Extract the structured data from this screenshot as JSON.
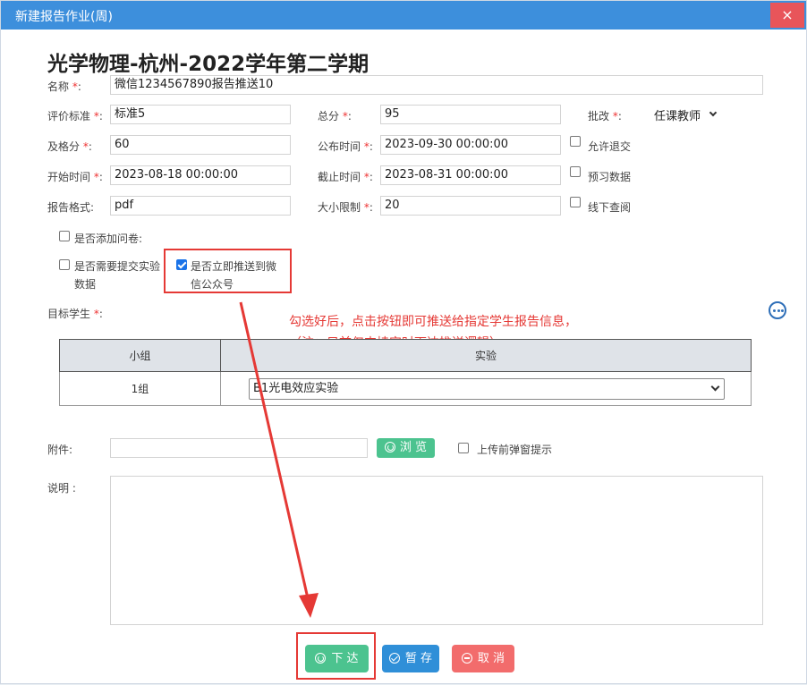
{
  "dialog": {
    "title": "新建报告作业(周)",
    "close_symbol": "×"
  },
  "heading": "光学物理-杭州-2022学年第二学期",
  "required_mark": "*",
  "fields": {
    "name": {
      "label": "名称",
      "value": "微信1234567890报告推送10"
    },
    "criteria": {
      "label": "评价标准",
      "value": "标准5"
    },
    "total": {
      "label": "总分",
      "value": "95"
    },
    "grader": {
      "label": "批改",
      "value": "任课教师"
    },
    "pass": {
      "label": "及格分",
      "value": "60"
    },
    "publish_time": {
      "label": "公布时间",
      "value": "2023-09-30 00:00:00"
    },
    "start_time": {
      "label": "开始时间",
      "value": "2023-08-18 00:00:00"
    },
    "deadline": {
      "label": "截止时间",
      "value": "2023-08-31 00:00:00"
    },
    "format": {
      "label": "报告格式:",
      "value": "pdf"
    },
    "size_limit": {
      "label": "大小限制",
      "value": "20"
    },
    "target": {
      "label": "目标学生"
    },
    "attachment": {
      "label": "附件:",
      "value": ""
    },
    "description": {
      "label": "说明 :"
    }
  },
  "checkboxes": {
    "allow_return": {
      "label": "允许退交",
      "checked": false
    },
    "preview_data": {
      "label": "预习数据",
      "checked": false
    },
    "offline_view": {
      "label": "线下查阅",
      "checked": false
    },
    "add_survey": {
      "label": "是否添加问卷:",
      "checked": false
    },
    "need_exp_data": {
      "label_line1": "是否需要提交实验",
      "label_line2": "数据",
      "checked": false
    },
    "push_wechat": {
      "label_line1": "是否立即推送到微",
      "label_line2": "信公众号",
      "checked": true
    },
    "upload_prompt": {
      "label": "上传前弹窗提示",
      "checked": false
    }
  },
  "annotation": {
    "line1": "勾选好后，点击按钮即可推送给指定学生报告信息，",
    "line2": "（注：目前仅支持实时下达推送逻辑）"
  },
  "group_table": {
    "headers": [
      "小组",
      "实验"
    ],
    "rows": [
      {
        "group": "1组",
        "experiment": "B1光电效应实验"
      }
    ]
  },
  "buttons": {
    "browse": "浏 览",
    "submit": "下 达",
    "save": "暂 存",
    "cancel": "取 消"
  },
  "colors": {
    "titlebar": "#3d8fdc",
    "close": "#e8555a",
    "submit": "#4cc38f",
    "save": "#2f8fd8",
    "cancel": "#f26c6c",
    "annotation": "#e53935"
  }
}
